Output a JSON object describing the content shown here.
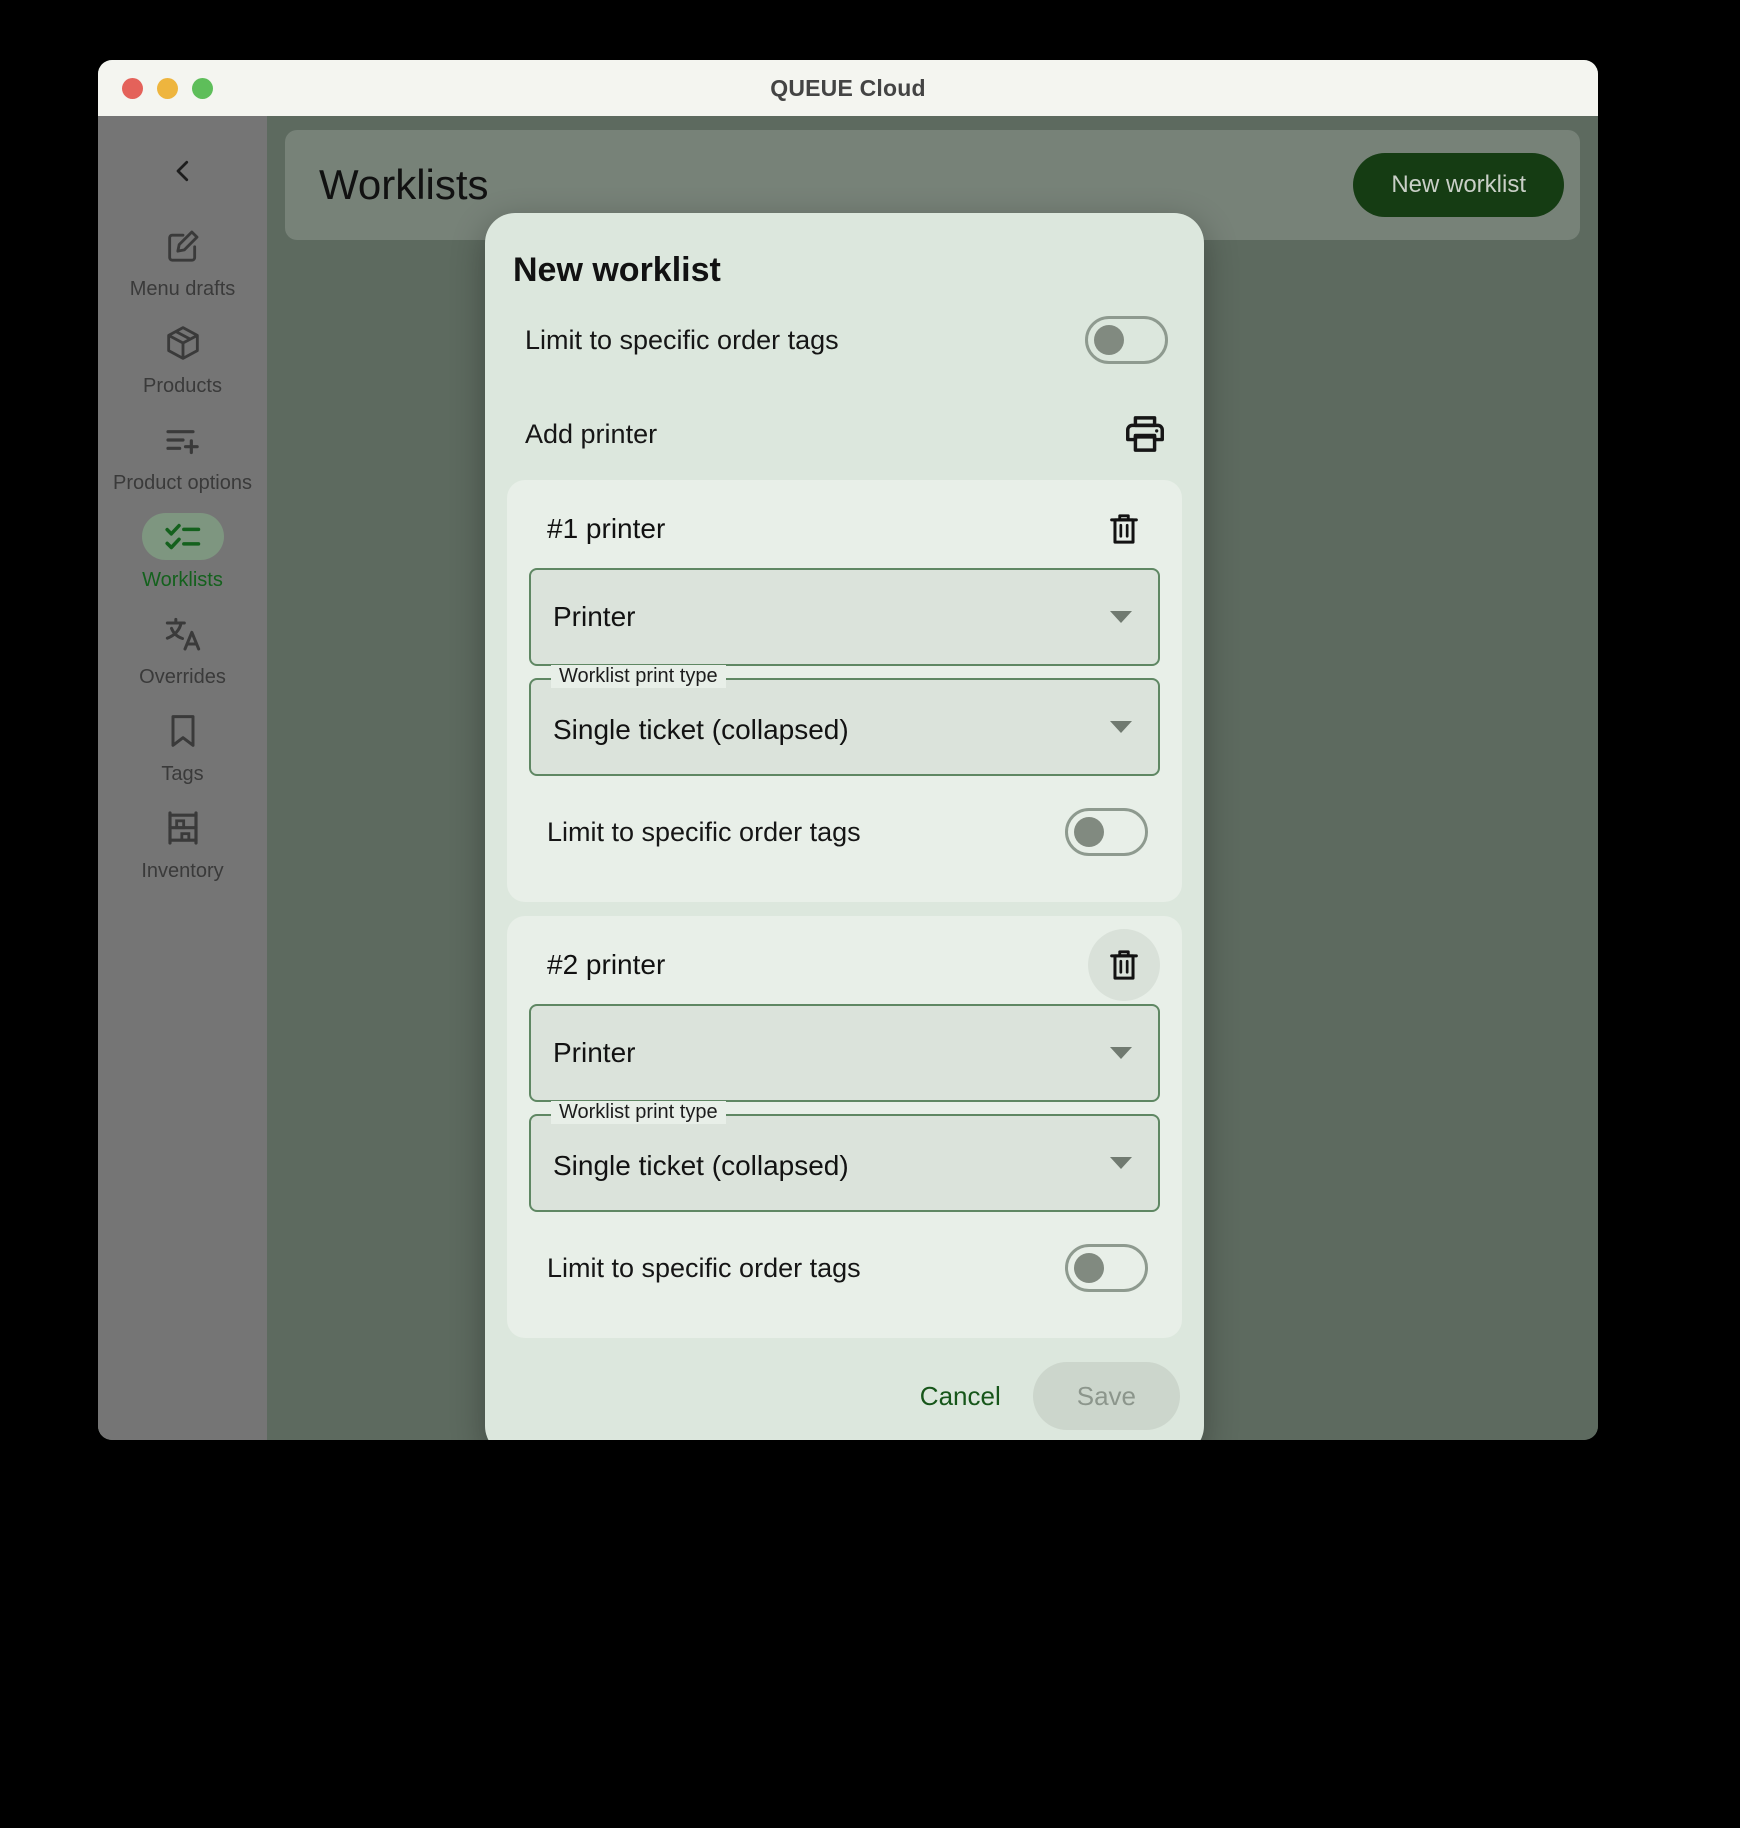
{
  "window": {
    "title": "QUEUE Cloud",
    "traffic_lights": [
      "close",
      "minimize",
      "maximize"
    ]
  },
  "sidebar": {
    "collapse_icon": "chevron-left-icon",
    "items": [
      {
        "label": "Menu drafts",
        "icon": "edit-square-icon",
        "active": false
      },
      {
        "label": "Products",
        "icon": "box-icon",
        "active": false
      },
      {
        "label": "Product options",
        "icon": "list-plus-icon",
        "active": false
      },
      {
        "label": "Worklists",
        "icon": "checklist-icon",
        "active": true
      },
      {
        "label": "Overrides",
        "icon": "translate-icon",
        "active": false
      },
      {
        "label": "Tags",
        "icon": "bookmark-icon",
        "active": false
      },
      {
        "label": "Inventory",
        "icon": "shelf-icon",
        "active": false
      }
    ]
  },
  "page": {
    "title": "Worklists",
    "new_worklist_label": "New worklist"
  },
  "modal": {
    "title": "New worklist",
    "limit_tags_label": "Limit to specific order tags",
    "limit_tags_value": "off",
    "add_printer_label": "Add printer",
    "add_printer_icon": "printer-icon",
    "printers": [
      {
        "heading": "#1 printer",
        "delete_icon": "trash-icon",
        "delete_hovered": false,
        "printer_select_value": "Printer",
        "print_type_label": "Worklist print type",
        "print_type_value": "Single ticket (collapsed)",
        "limit_tags_label": "Limit to specific order tags",
        "limit_tags_value": "off"
      },
      {
        "heading": "#2 printer",
        "delete_icon": "trash-icon",
        "delete_hovered": true,
        "printer_select_value": "Printer",
        "print_type_label": "Worklist print type",
        "print_type_value": "Single ticket (collapsed)",
        "limit_tags_label": "Limit to specific order tags",
        "limit_tags_value": "off"
      }
    ],
    "cancel_label": "Cancel",
    "save_label": "Save",
    "save_enabled": false
  },
  "colors": {
    "accent_dark_green": "#153c13",
    "modal_bg": "#dce7dd",
    "card_bg": "#e8efe8",
    "select_border": "#5f8763",
    "sidebar_bg": "#757575",
    "active_pill": "#7e9680",
    "active_text": "#14611d",
    "titlebar_bg": "#f4f5f0",
    "scrim_bg": "#5d6a5f"
  }
}
